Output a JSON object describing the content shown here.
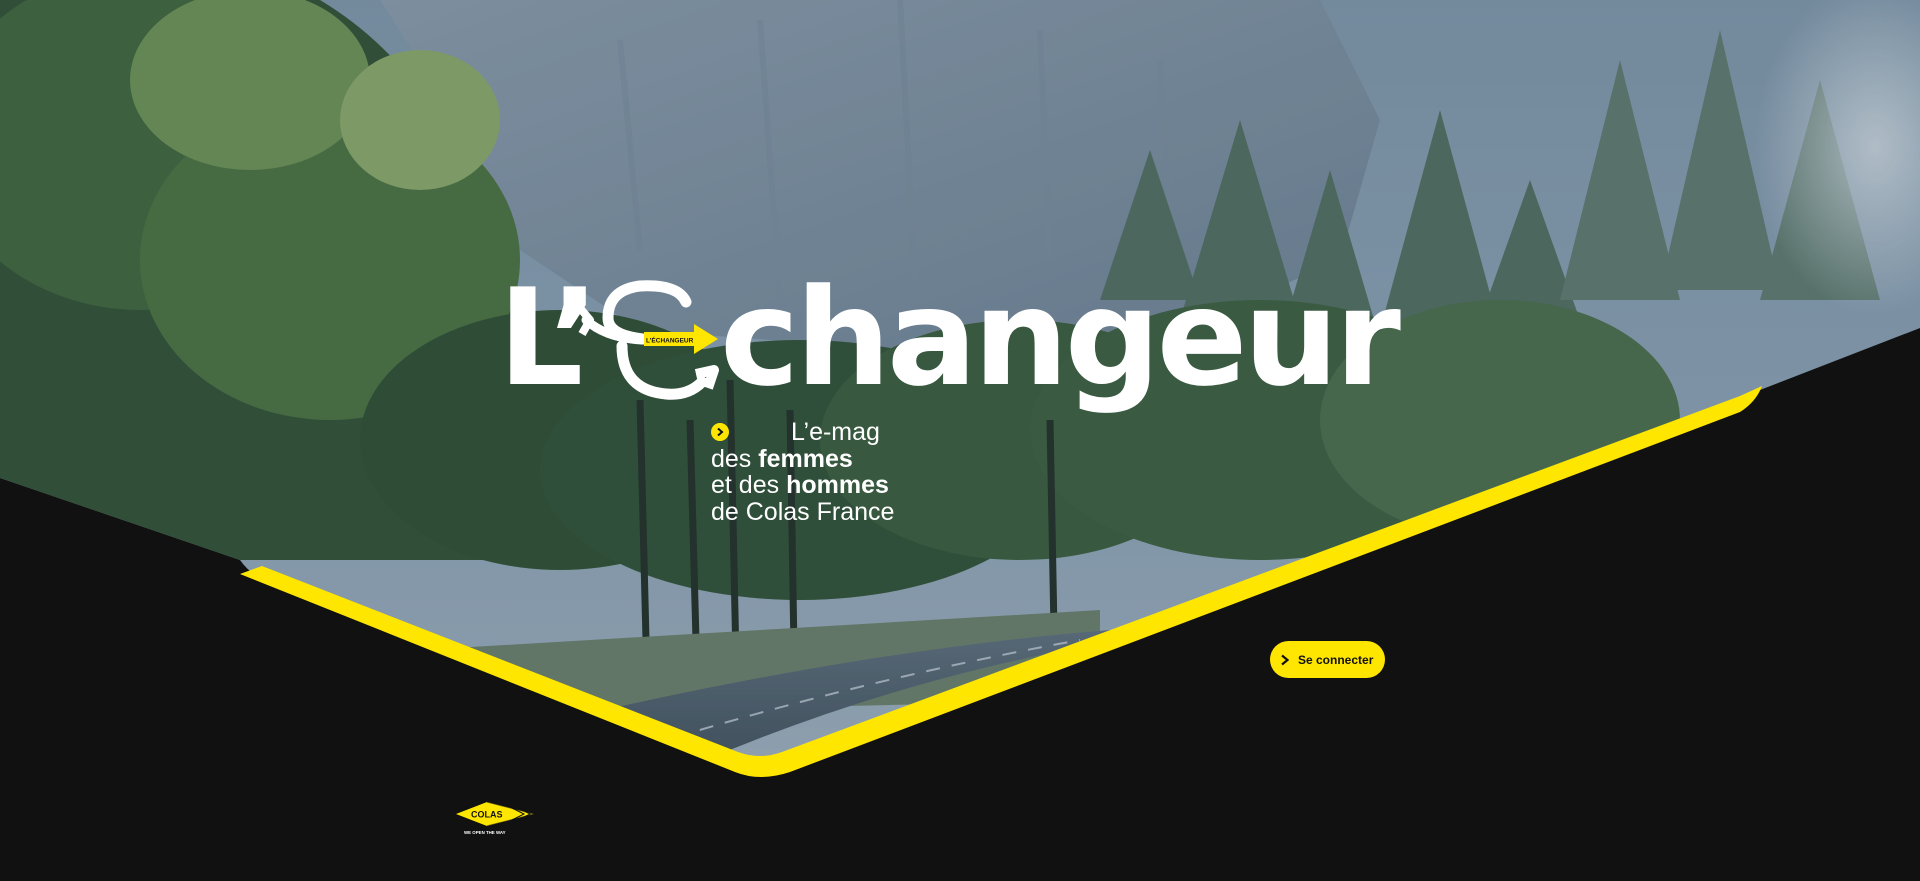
{
  "hero": {
    "logo_l": "L’",
    "logo_rest": "changeur",
    "logo_arrow_text": "L’ÉCHANGEUR",
    "tagline": {
      "line1": "L’e-mag",
      "line2_prefix": "des ",
      "line2_bold": "femmes",
      "line3_prefix": "et des ",
      "line3_bold": "hommes",
      "line4": "de Colas France"
    }
  },
  "login": {
    "label": "Se connecter"
  },
  "footer": {
    "brand": "COLAS",
    "brand_slogan": "WE OPEN THE WAY"
  },
  "colors": {
    "accent": "#ffe600",
    "background": "#111111",
    "text": "#ffffff"
  },
  "icons": {
    "login": "chevron-right-icon",
    "tagline": "arrow-right-circle-icon",
    "logo": "colas-diamond-logo"
  }
}
